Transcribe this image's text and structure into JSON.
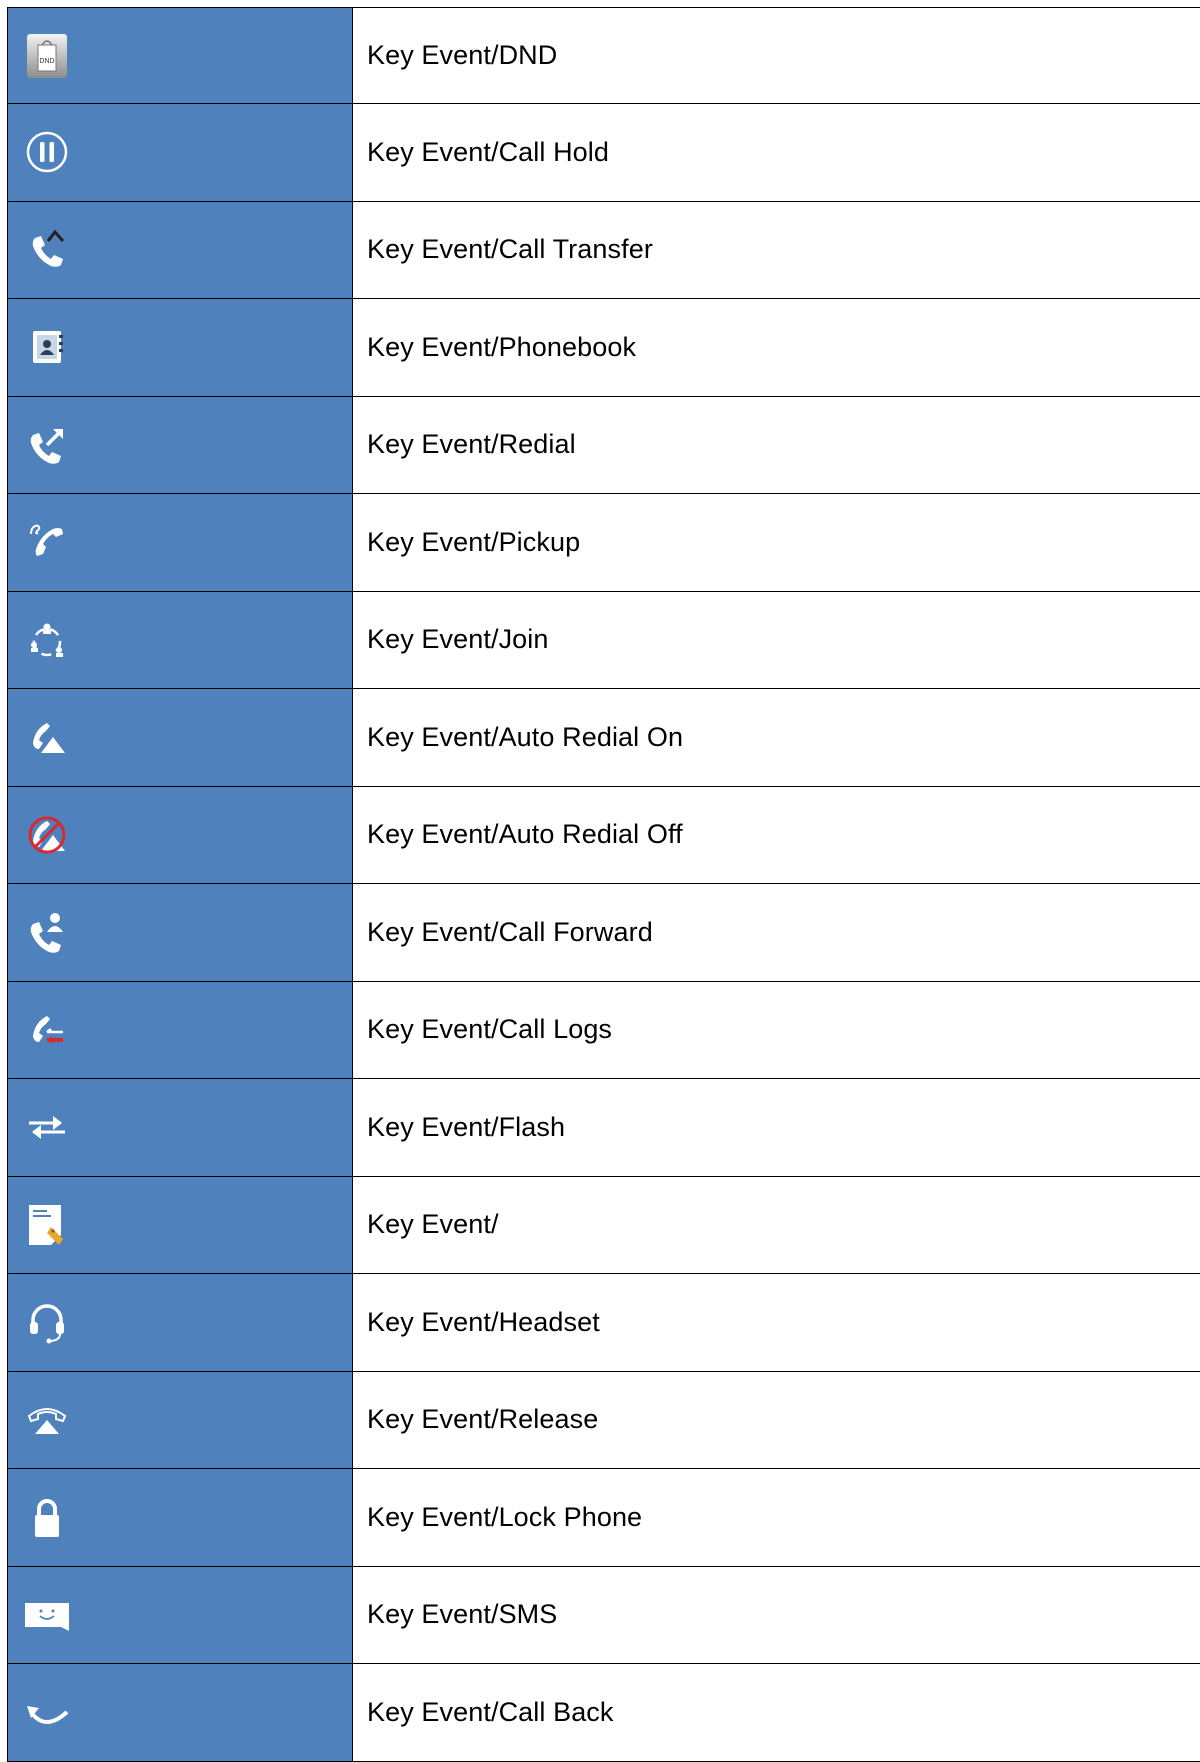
{
  "rows": [
    {
      "icon": "dnd-tag-icon",
      "label": "Key Event/DND"
    },
    {
      "icon": "pause-circle-icon",
      "label": "Key Event/Call Hold"
    },
    {
      "icon": "phone-transfer-icon",
      "label": "Key Event/Call Transfer"
    },
    {
      "icon": "phonebook-icon",
      "label": "Key Event/Phonebook"
    },
    {
      "icon": "phone-redial-icon",
      "label": "Key Event/Redial"
    },
    {
      "icon": "phone-pickup-icon",
      "label": "Key Event/Pickup"
    },
    {
      "icon": "join-conference-icon",
      "label": "Key Event/Join"
    },
    {
      "icon": "auto-redial-on-icon",
      "label": "Key Event/Auto Redial On"
    },
    {
      "icon": "auto-redial-off-icon",
      "label": "Key Event/Auto Redial Off"
    },
    {
      "icon": "call-forward-icon",
      "label": "Key Event/Call Forward"
    },
    {
      "icon": "call-logs-icon",
      "label": "Key Event/Call Logs"
    },
    {
      "icon": "flash-arrows-icon",
      "label": "Key Event/Flash"
    },
    {
      "icon": "memo-tag-icon",
      "label": "Key Event/"
    },
    {
      "icon": "headset-icon",
      "label": "Key Event/Headset"
    },
    {
      "icon": "release-icon",
      "label": "Key Event/Release"
    },
    {
      "icon": "lock-icon",
      "label": "Key Event/Lock Phone"
    },
    {
      "icon": "sms-icon",
      "label": "Key Event/SMS"
    },
    {
      "icon": "call-back-icon",
      "label": "Key Event/Call Back"
    }
  ],
  "dnd_icon_text": "DND",
  "colors": {
    "icon_cell_background": "#4f81bd",
    "border": "#000000",
    "icon_white": "#ffffff",
    "accent_red": "#d9282f",
    "tag_orange": "#e8a82a"
  }
}
